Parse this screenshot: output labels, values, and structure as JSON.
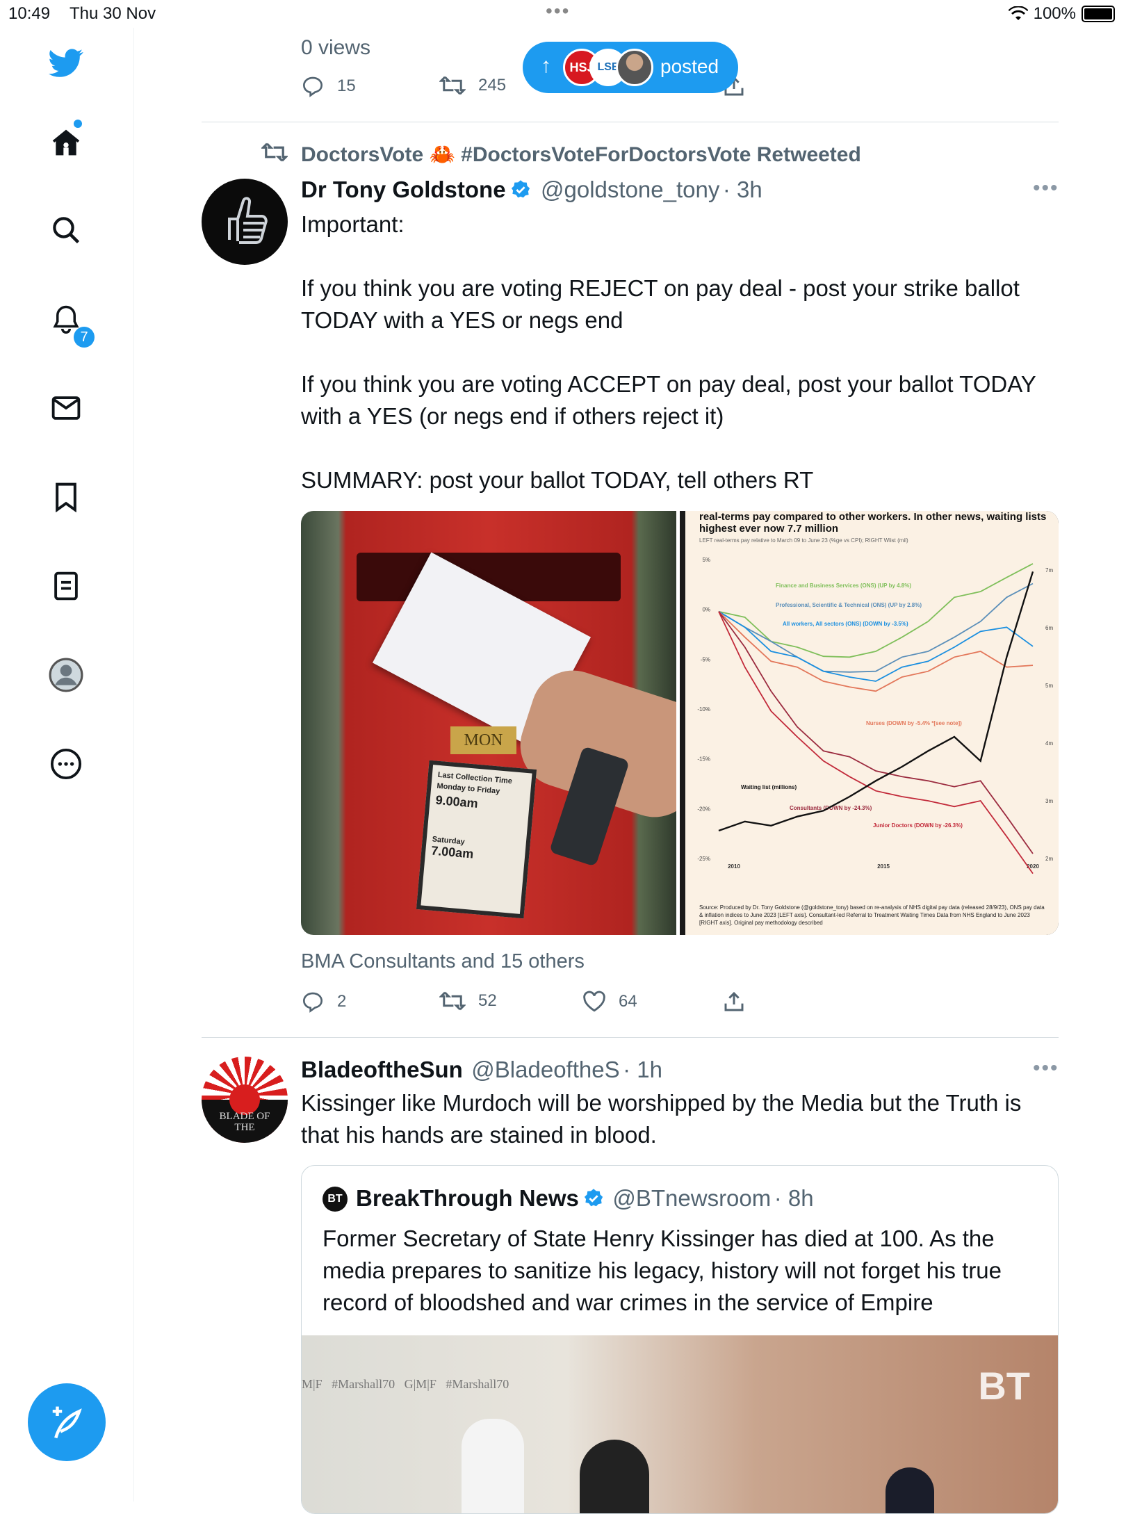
{
  "status_bar": {
    "time": "10:49",
    "date": "Thu 30 Nov",
    "battery": "100%"
  },
  "sidebar": {
    "notifications_badge": "7"
  },
  "prev_tweet": {
    "views": "0 views",
    "replies": "15",
    "retweets": "245"
  },
  "toast": {
    "label": "posted",
    "avatar1": "HSJ",
    "avatar2": "LSE"
  },
  "tweet1": {
    "retweet_context": "DoctorsVote 🦀 #DoctorsVoteForDoctorsVote Retweeted",
    "author": "Dr Tony Goldstone",
    "handle": "@goldstone_tony",
    "time": "· 3h",
    "text": "Important:\n\nIf you think you are voting REJECT on pay deal - post your strike ballot TODAY with a YES or negs end\n\nIf you think you are voting ACCEPT on pay deal, post your ballot TODAY with a YES (or negs end if others reject it)\n\nSUMMARY: post your ballot TODAY, tell others RT",
    "liked_by": "BMA Consultants and 15 others",
    "replies": "2",
    "retweets": "52",
    "likes": "64",
    "photo_box": {
      "line1": "Last Collection Time",
      "line2": "Monday to Friday",
      "line3": "9.00am",
      "line4": "Saturday",
      "line5": "7.00am",
      "plate": "MON"
    }
  },
  "chart_data": {
    "type": "line",
    "title": "real-terms pay compared to other workers. In other news, waiting lists highest ever now 7.7 million",
    "subtitle": "LEFT real-terms pay relative to March 09 to June 23 (%ge vs CPI); RIGHT Wlist (mil)",
    "left_ticks": [
      "5%",
      "0%",
      "-5%",
      "-10%",
      "-15%",
      "-20%",
      "-25%"
    ],
    "right_ticks": [
      "7m",
      "6m",
      "5m",
      "4m",
      "3m",
      "2m"
    ],
    "x_ticks": [
      "2010",
      "2015",
      "2020"
    ],
    "ylim": [
      -25,
      5
    ],
    "series": [
      {
        "name": "Finance and Business Services (ONS) (UP by 4.8%)",
        "color": "#7fbf5a",
        "values": [
          0,
          -1,
          -3,
          -4,
          -4.5,
          -5,
          -4,
          -3,
          -1,
          1,
          2,
          3,
          4.8
        ]
      },
      {
        "name": "Professional, Scientific & Technical (ONS) (UP by 2.8%)",
        "color": "#5b8fb9",
        "values": [
          0,
          -2,
          -3,
          -5,
          -6,
          -6.5,
          -6,
          -5,
          -4,
          -3,
          -1,
          1,
          2.8
        ]
      },
      {
        "name": "All workers, All sectors (ONS) (DOWN by -3.5%)",
        "color": "#1a8fe0",
        "values": [
          0,
          -2,
          -4,
          -5,
          -6,
          -7,
          -7,
          -6,
          -5,
          -4,
          -2,
          -2,
          -3.5
        ]
      },
      {
        "name": "Nurses (DOWN by -5.4% *[see note])",
        "color": "#e3775a",
        "values": [
          0,
          -3,
          -5,
          -6,
          -7,
          -8,
          -8,
          -7,
          -6,
          -5,
          -4,
          -6,
          -5.4
        ]
      },
      {
        "name": "Consultants (DOWN by -24.3%)",
        "color": "#9b2b3f",
        "values": [
          0,
          -4,
          -8,
          -12,
          -14,
          -15,
          -16,
          -17,
          -17,
          -18,
          -17,
          -21,
          -24.3
        ]
      },
      {
        "name": "Junior Doctors (DOWN by -26.3%)",
        "color": "#c22a3a",
        "values": [
          0,
          -6,
          -10,
          -13,
          -15,
          -17,
          -18,
          -19,
          -19,
          -20,
          -19,
          -23,
          -26.3
        ]
      },
      {
        "name": "Waiting list (millions)",
        "color": "#111111",
        "values": [
          -22,
          -21.5,
          -21.5,
          -21,
          -20,
          -19,
          -17,
          -16,
          -14,
          -13,
          -15,
          -5,
          4
        ]
      }
    ],
    "source": "Source: Produced by Dr. Tony Goldstone (@goldstone_tony) based on re-analysis of NHS digital pay data (released 28/9/23), ONS pay data & inflation indices to June 2023 [LEFT axis]. Consultant-led Referral to Treatment Waiting Times Data from NHS England to June 2023 [RIGHT axis]. Original pay methodology described"
  },
  "tweet2": {
    "author": "BladeoftheSun",
    "handle": "@BladeoftheS",
    "time": "· 1h",
    "avatar_text": "BLADE OF THE",
    "text": "Kissinger like Murdoch will be worshipped by the Media but the Truth is that his hands are stained in blood.",
    "quote": {
      "author": "BreakThrough News",
      "handle": "@BTnewsroom",
      "time": "· 8h",
      "text": "Former Secretary of State Henry Kissinger has died at 100. As the media prepares to sanitize his legacy, history will not forget his true record of bloodshed and war crimes in the service of Empire",
      "media_banner": "M|F   #Marshall70   G|M|F   #Marshall70",
      "watermark": "BT"
    }
  },
  "colors": {
    "accent": "#1d9bf0",
    "muted": "#536471"
  }
}
